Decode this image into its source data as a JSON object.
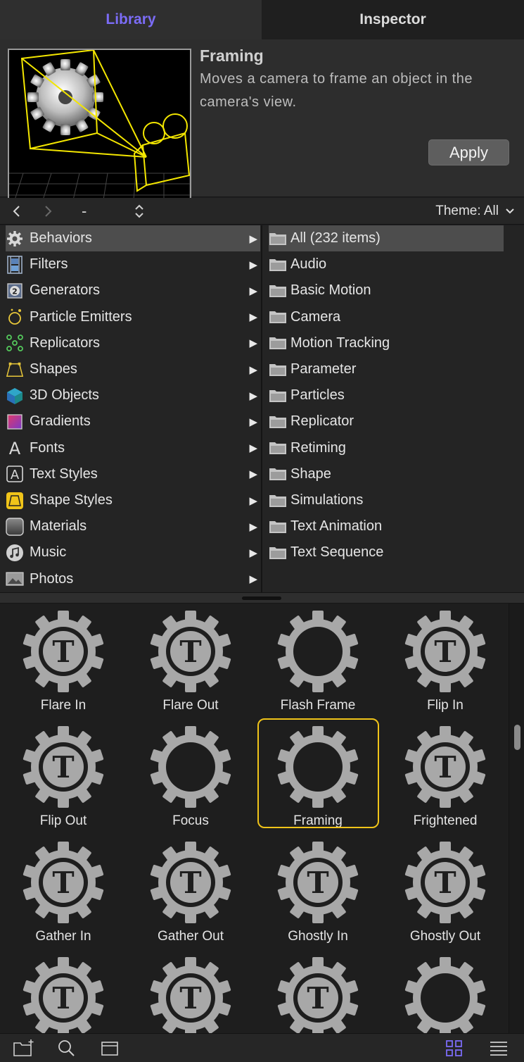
{
  "tabs": {
    "library": "Library",
    "inspector": "Inspector"
  },
  "preview": {
    "title": "Framing",
    "description": "Moves a camera to frame an object in the camera's view.",
    "apply_label": "Apply"
  },
  "navbar": {
    "back": "<",
    "forward": ">",
    "location": "-",
    "stepper": "⌃⌄",
    "theme": "Theme: All"
  },
  "categories": [
    {
      "label": "Behaviors",
      "icon": "gear-icon"
    },
    {
      "label": "Filters",
      "icon": "film-icon"
    },
    {
      "label": "Generators",
      "icon": "generator-icon"
    },
    {
      "label": "Particle Emitters",
      "icon": "emitter-icon"
    },
    {
      "label": "Replicators",
      "icon": "replicator-icon"
    },
    {
      "label": "Shapes",
      "icon": "shape-icon"
    },
    {
      "label": "3D Objects",
      "icon": "cube-icon"
    },
    {
      "label": "Gradients",
      "icon": "gradient-icon"
    },
    {
      "label": "Fonts",
      "icon": "font-icon"
    },
    {
      "label": "Text Styles",
      "icon": "text-style-icon"
    },
    {
      "label": "Shape Styles",
      "icon": "shape-style-icon"
    },
    {
      "label": "Materials",
      "icon": "material-icon"
    },
    {
      "label": "Music",
      "icon": "music-icon"
    },
    {
      "label": "Photos",
      "icon": "photo-icon"
    }
  ],
  "subcategories": [
    "All (232 items)",
    "Audio",
    "Basic Motion",
    "Camera",
    "Motion Tracking",
    "Parameter",
    "Particles",
    "Replicator",
    "Retiming",
    "Shape",
    "Simulations",
    "Text Animation",
    "Text Sequence"
  ],
  "items": [
    {
      "label": "Flare In",
      "t": true
    },
    {
      "label": "Flare Out",
      "t": true
    },
    {
      "label": "Flash Frame",
      "t": false
    },
    {
      "label": "Flip In",
      "t": true
    },
    {
      "label": "Flip Out",
      "t": true
    },
    {
      "label": "Focus",
      "t": false
    },
    {
      "label": "Framing",
      "t": false
    },
    {
      "label": "Frightened",
      "t": true
    },
    {
      "label": "Gather In",
      "t": true
    },
    {
      "label": "Gather Out",
      "t": true
    },
    {
      "label": "Ghostly In",
      "t": true
    },
    {
      "label": "Ghostly Out",
      "t": true
    },
    {
      "label": "",
      "t": true
    },
    {
      "label": "",
      "t": true
    },
    {
      "label": "",
      "t": true
    },
    {
      "label": "",
      "t": false
    }
  ],
  "gear_letter": "T",
  "colors": {
    "accent": "#7b6cf6",
    "selection": "#f0c419",
    "gear": "#a8a8a8"
  }
}
